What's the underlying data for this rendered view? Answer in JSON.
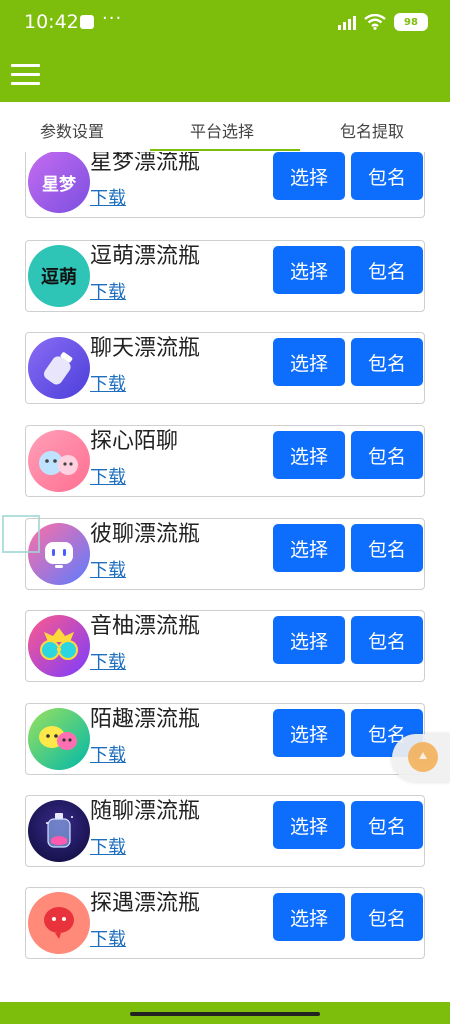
{
  "status_bar": {
    "time": "10:42",
    "more": "···",
    "battery": "98"
  },
  "tabs": [
    {
      "label": "参数设置"
    },
    {
      "label": "平台选择"
    },
    {
      "label": "包名提取"
    }
  ],
  "active_tab": "平台选择",
  "accent_color": "#7dbd0c",
  "button_color": "#0d6efd",
  "apps": [
    {
      "name": "星梦漂流瓶",
      "download": "下载",
      "select": "选择",
      "package": "包名",
      "avatar_text": "星梦",
      "icon": "xingmeng-logo-icon"
    },
    {
      "name": "逗萌漂流瓶",
      "download": "下载",
      "select": "选择",
      "package": "包名",
      "avatar_text": "逗萌",
      "icon": "doumeng-logo-icon"
    },
    {
      "name": "聊天漂流瓶",
      "download": "下载",
      "select": "选择",
      "package": "包名",
      "icon": "bottle-logo-icon"
    },
    {
      "name": "探心陌聊",
      "download": "下载",
      "select": "选择",
      "package": "包名",
      "icon": "tanxin-logo-icon"
    },
    {
      "name": "彼聊漂流瓶",
      "download": "下载",
      "select": "选择",
      "package": "包名",
      "icon": "robot-logo-icon"
    },
    {
      "name": "音柚漂流瓶",
      "download": "下载",
      "select": "选择",
      "package": "包名",
      "icon": "yinyou-logo-icon"
    },
    {
      "name": "陌趣漂流瓶",
      "download": "下载",
      "select": "选择",
      "package": "包名",
      "icon": "moqu-logo-icon"
    },
    {
      "name": "随聊漂流瓶",
      "download": "下载",
      "select": "选择",
      "package": "包名",
      "icon": "suiliao-bottle-icon"
    },
    {
      "name": "探遇漂流瓶",
      "download": "下载",
      "select": "选择",
      "package": "包名",
      "icon": "tanyu-logo-icon"
    }
  ]
}
